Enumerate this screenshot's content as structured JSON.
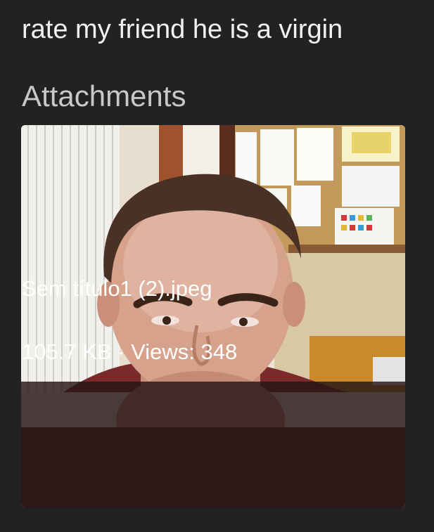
{
  "post": {
    "text": "rate my friend he is a virgin"
  },
  "attachments": {
    "heading": "Attachments",
    "items": [
      {
        "file_name": "Sem título1 (2).jpeg",
        "size": "105.7 KB",
        "separator": " · ",
        "views_label": "Views:",
        "views_count": "348"
      }
    ]
  },
  "colors": {
    "background": "#222222",
    "text": "#f2f2f2",
    "heading": "#c8c8c8",
    "overlay": "#261616"
  }
}
